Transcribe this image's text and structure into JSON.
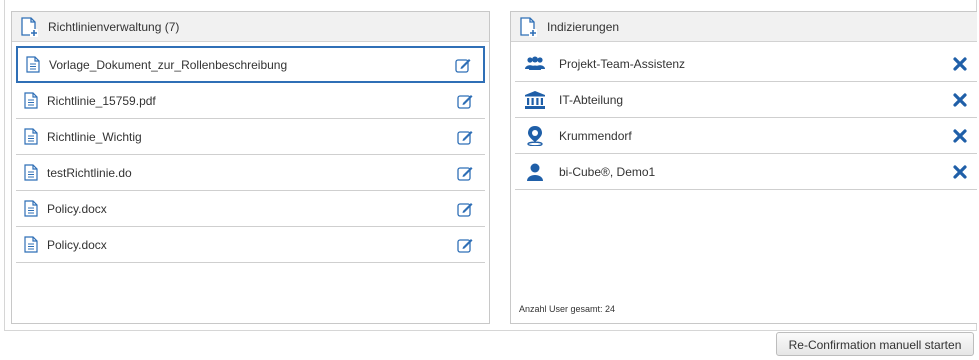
{
  "left_panel": {
    "title": "Richtlinienverwaltung (7)",
    "items": [
      {
        "label": "Vorlage_Dokument_zur_Rollenbeschreibung",
        "icon": "document-icon",
        "action_icon": "edit-icon"
      },
      {
        "label": "Richtlinie_15759.pdf",
        "icon": "document-icon",
        "action_icon": "edit-icon"
      },
      {
        "label": "Richtlinie_Wichtig",
        "icon": "document-icon",
        "action_icon": "edit-icon"
      },
      {
        "label": "testRichtlinie.do",
        "icon": "document-icon",
        "action_icon": "edit-icon"
      },
      {
        "label": "Policy.docx",
        "icon": "document-icon",
        "action_icon": "edit-icon"
      },
      {
        "label": "Policy.docx",
        "icon": "document-icon",
        "action_icon": "edit-icon"
      }
    ]
  },
  "right_panel": {
    "title": "Indizierungen",
    "items": [
      {
        "label": "Projekt-Team-Assistenz",
        "icon": "group-icon"
      },
      {
        "label": "IT-Abteilung",
        "icon": "institution-icon"
      },
      {
        "label": "Krummendorf",
        "icon": "location-pin-icon"
      },
      {
        "label": "bi-Cube®, Demo1",
        "icon": "user-icon"
      }
    ],
    "footer": "Anzahl User gesamt: 24"
  },
  "button": {
    "label": "Re-Confirmation manuell starten"
  },
  "colors": {
    "accent": "#2f6fb6",
    "icon_blue": "#1f5fa8",
    "header_bg": "#f1f1f1",
    "border": "#c8c8c8"
  }
}
